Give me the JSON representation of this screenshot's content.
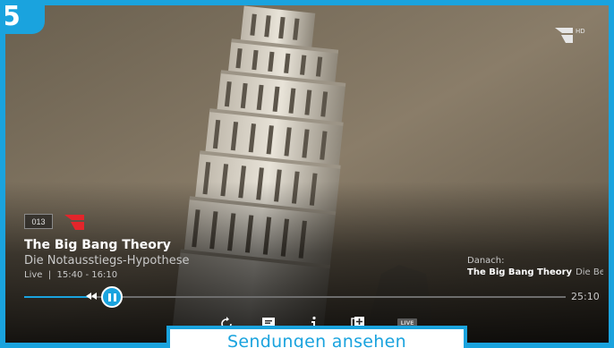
{
  "step_badge": "5",
  "colors": {
    "accent": "#1aa3de",
    "channel_red": "#e3252b"
  },
  "channel": {
    "number": "013",
    "logo": "prosieben-red-logo",
    "corner_logo": "prosieben-hd-logo",
    "corner_logo_text": "HD"
  },
  "program": {
    "title": "The Big Bang Theory",
    "episode": "Die Notausstiegs-Hypothese",
    "time_info": "Live  |  15:40 - 16:10",
    "progress": 0.12
  },
  "next": {
    "label": "Danach:",
    "title": "The Big Bang Theory",
    "episode": "Die Bes..."
  },
  "player": {
    "duration": "25:10",
    "live_label": "LIVE",
    "controls": [
      "restart-icon",
      "subtitles-icon",
      "info-icon",
      "add-recording-icon"
    ]
  },
  "cta": {
    "label": "Sendungen ansehen"
  }
}
